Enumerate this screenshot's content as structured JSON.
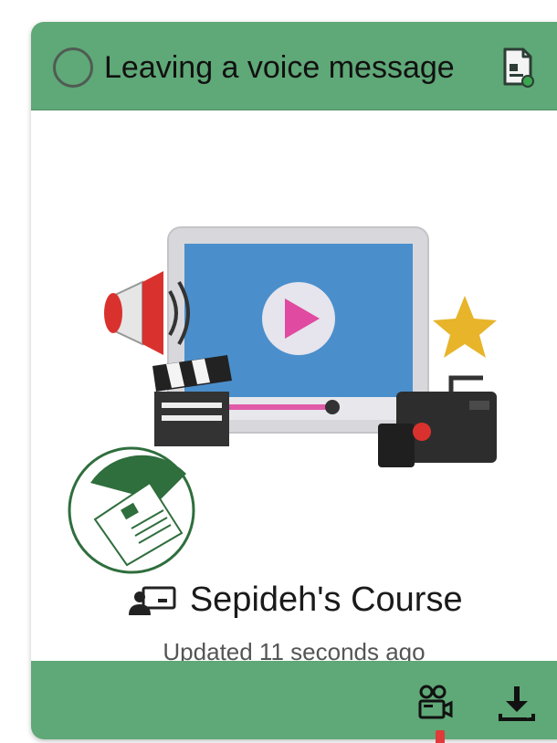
{
  "card": {
    "title": "Leaving a voice message",
    "course_name": "Sepideh's Course",
    "updated": "Updated 11 seconds ago"
  },
  "icons": {
    "status": "status-circle-icon",
    "document": "document-check-icon",
    "course": "teacher-presentation-icon",
    "video_action": "video-camera-icon",
    "download_action": "download-icon"
  },
  "colors": {
    "header_green": "#5fa877",
    "footer_green": "#5fa877",
    "marker_red": "#e03a3a"
  }
}
